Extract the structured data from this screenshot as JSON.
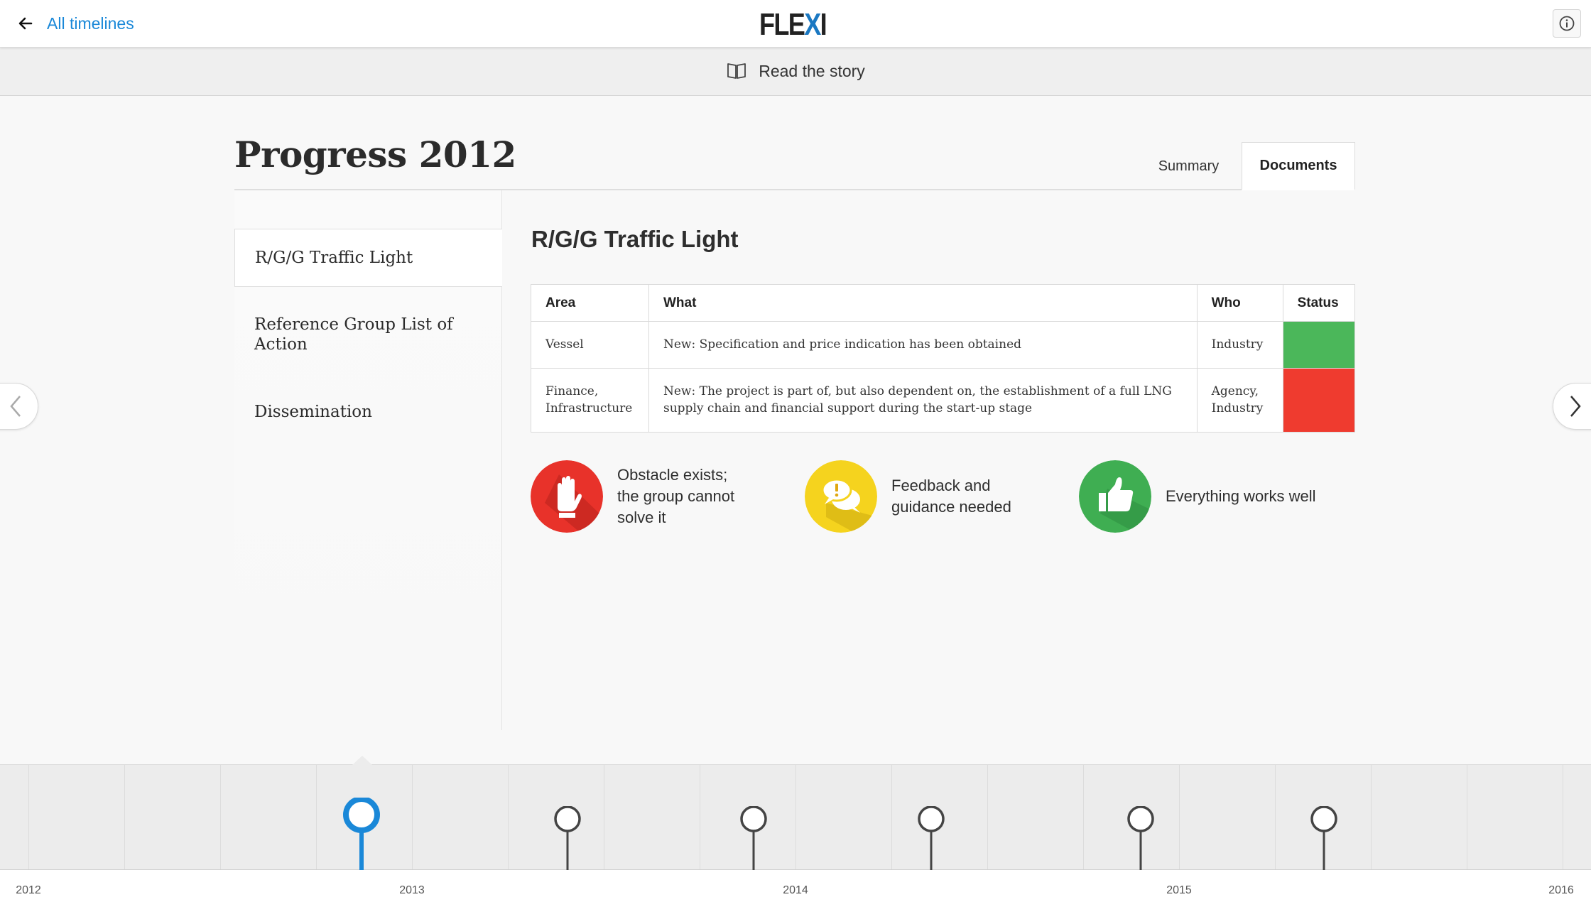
{
  "header": {
    "back_label": "All timelines",
    "logo_main": "FLE",
    "logo_accent": "X",
    "logo_end": "I"
  },
  "storybar": {
    "label": "Read the story"
  },
  "page": {
    "title": "Progress 2012"
  },
  "tabs": [
    {
      "label": "Summary",
      "active": false
    },
    {
      "label": "Documents",
      "active": true
    }
  ],
  "sidebar": {
    "items": [
      {
        "label": "R/G/G Traffic Light",
        "active": true
      },
      {
        "label": "Reference Group List of Action",
        "active": false
      },
      {
        "label": "Dissemination",
        "active": false
      }
    ]
  },
  "content": {
    "title": "R/G/G Traffic Light",
    "table": {
      "headers": [
        "Area",
        "What",
        "Who",
        "Status"
      ],
      "rows": [
        {
          "area": "Vessel",
          "what": "New: Specification and price indication has been obtained",
          "who": "Industry",
          "status": "green"
        },
        {
          "area": "Finance, Infrastructure",
          "what": "New: The project is part of, but also dependent on, the establishment of a full LNG supply chain and financial support during the start-up stage",
          "who": "Agency, Industry",
          "status": "red"
        }
      ]
    },
    "legend": [
      {
        "label": "Obstacle exists; the group cannot solve it",
        "color": "#e8322a",
        "icon": "hand-stop-icon"
      },
      {
        "label": "Feedback and guidance needed",
        "color": "#f5d31e",
        "icon": "speech-bubbles-icon"
      },
      {
        "label": "Everything works well",
        "color": "#3fae52",
        "icon": "thumbs-up-icon"
      }
    ]
  },
  "colors": {
    "accent": "#1a88d8",
    "status_green": "#4bb75a",
    "status_red": "#ef3b2f",
    "timeline_active": "#1a88d8"
  },
  "timeline": {
    "years": [
      "2012",
      "2013",
      "2014",
      "2015",
      "2016"
    ],
    "active_marker": 0,
    "marker_count": 6
  }
}
